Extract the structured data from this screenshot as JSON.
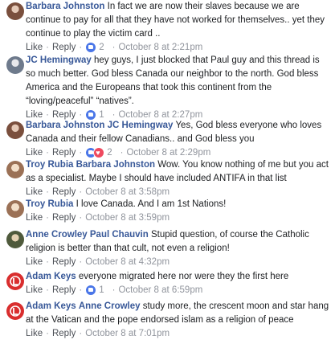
{
  "colors": {
    "link": "#385898",
    "meta": "#90949c"
  },
  "comments": [
    {
      "author": "Barbara Johnston",
      "mention": "",
      "lines": [
        "In fact we are now their slaves because we are",
        "continue to pay for all that they have not worked for themselves.. yet they",
        "continue to play the victim card .."
      ],
      "like": "Like",
      "reply": "Reply",
      "reaction_count": "2",
      "time": "October 8 at 2:21pm",
      "avatar_icon": "user-photo-icon"
    },
    {
      "author": "JC Hemingway",
      "mention": "",
      "lines": [
        "hey guys, I just blocked that Paul guy and this thread is",
        "so much better. God bless Canada our neighbor to the north. God bless",
        "America and the Europeans that took this continent from the",
        "“loving/peaceful” “natives”."
      ],
      "like": "Like",
      "reply": "Reply",
      "reaction_count": "1",
      "time": "October 8 at 2:27pm",
      "avatar_icon": "user-photo-icon"
    },
    {
      "author": "Barbara Johnston",
      "mention": "JC Hemingway",
      "lines": [
        "Yes, God bless everyone who loves",
        "Canada and their fellow Canadians.. and God bless you"
      ],
      "like": "Like",
      "reply": "Reply",
      "reaction_count": "2",
      "time": "October 8 at 2:29pm",
      "avatar_icon": "user-photo-icon"
    },
    {
      "author": "Troy Rubia",
      "mention": "Barbara Johnston",
      "lines": [
        "Wow. You know nothing of me but you act",
        "as a specialist. Maybe I should have included ANTIFA in that list"
      ],
      "like": "Like",
      "reply": "Reply",
      "reaction_count": "",
      "time": "October 8 at 3:58pm",
      "avatar_icon": "user-photo-icon"
    },
    {
      "author": "Troy Rubia",
      "mention": "",
      "lines": [
        "I love Canada. And I am 1st Nations!"
      ],
      "like": "Like",
      "reply": "Reply",
      "reaction_count": "",
      "time": "October 8 at 3:59pm",
      "avatar_icon": "user-photo-icon"
    },
    {
      "author": "Anne Crowley",
      "mention": "Paul Chauvin",
      "lines": [
        "Stupid question, of course the Catholic",
        "religion is better than that cult, not even a religion!"
      ],
      "like": "Like",
      "reply": "Reply",
      "reaction_count": "",
      "time": "October 8 at 4:32pm",
      "avatar_icon": "user-photo-icon"
    },
    {
      "author": "Adam Keys",
      "mention": "",
      "lines": [
        "everyone migrated here nor were they the first here"
      ],
      "like": "Like",
      "reply": "Reply",
      "reaction_count": "1",
      "time": "October 8 at 6:59pm",
      "avatar_icon": "logo-icon"
    },
    {
      "author": "Adam Keys",
      "mention": "Anne Crowley",
      "lines": [
        "study more, the crescent moon and star hang",
        "at the Vatican and the pope endorsed islam as a religion of peace"
      ],
      "like": "Like",
      "reply": "Reply",
      "reaction_count": "",
      "time": "October 8 at 7:01pm",
      "avatar_icon": "logo-icon"
    }
  ]
}
